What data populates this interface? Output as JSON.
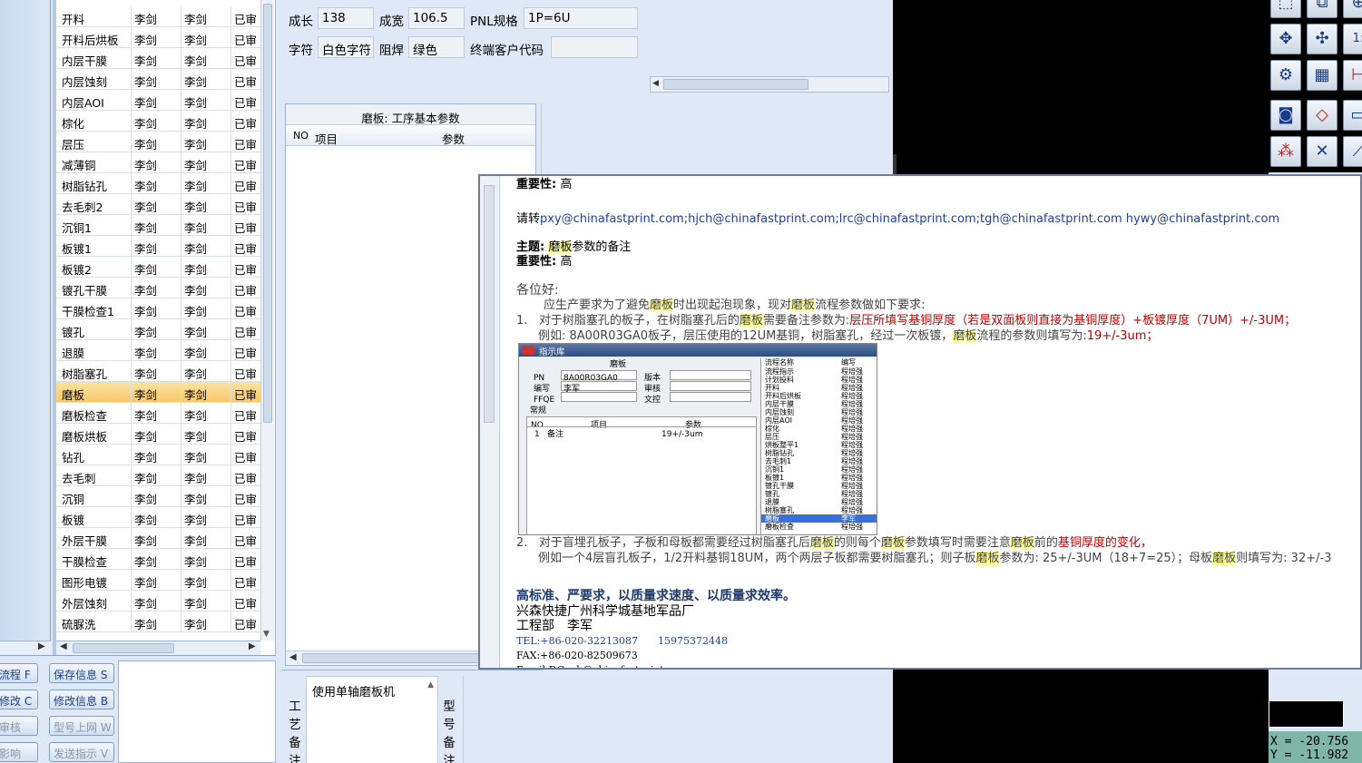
{
  "process_list": {
    "rows": [
      {
        "name": "开料",
        "c1": "李剑",
        "c2": "李剑",
        "c3": "已审"
      },
      {
        "name": "开料后烘板",
        "c1": "李剑",
        "c2": "李剑",
        "c3": "已审"
      },
      {
        "name": "内层干膜",
        "c1": "李剑",
        "c2": "李剑",
        "c3": "已审"
      },
      {
        "name": "内层蚀刻",
        "c1": "李剑",
        "c2": "李剑",
        "c3": "已审"
      },
      {
        "name": "内层AOI",
        "c1": "李剑",
        "c2": "李剑",
        "c3": "已审"
      },
      {
        "name": "棕化",
        "c1": "李剑",
        "c2": "李剑",
        "c3": "已审"
      },
      {
        "name": "层压",
        "c1": "李剑",
        "c2": "李剑",
        "c3": "已审"
      },
      {
        "name": "减薄铜",
        "c1": "李剑",
        "c2": "李剑",
        "c3": "已审"
      },
      {
        "name": "树脂钻孔",
        "c1": "李剑",
        "c2": "李剑",
        "c3": "已审"
      },
      {
        "name": "去毛刺2",
        "c1": "李剑",
        "c2": "李剑",
        "c3": "已审"
      },
      {
        "name": "沉铜1",
        "c1": "李剑",
        "c2": "李剑",
        "c3": "已审"
      },
      {
        "name": "板镀1",
        "c1": "李剑",
        "c2": "李剑",
        "c3": "已审"
      },
      {
        "name": "板镀2",
        "c1": "李剑",
        "c2": "李剑",
        "c3": "已审"
      },
      {
        "name": "镀孔干膜",
        "c1": "李剑",
        "c2": "李剑",
        "c3": "已审"
      },
      {
        "name": "干膜检查1",
        "c1": "李剑",
        "c2": "李剑",
        "c3": "已审"
      },
      {
        "name": "镀孔",
        "c1": "李剑",
        "c2": "李剑",
        "c3": "已审"
      },
      {
        "name": "退膜",
        "c1": "李剑",
        "c2": "李剑",
        "c3": "已审"
      },
      {
        "name": "树脂塞孔",
        "c1": "李剑",
        "c2": "李剑",
        "c3": "已审"
      },
      {
        "name": "磨板",
        "c1": "李剑",
        "c2": "李剑",
        "c3": "已审"
      },
      {
        "name": "磨板检查",
        "c1": "李剑",
        "c2": "李剑",
        "c3": "已审"
      },
      {
        "name": "磨板烘板",
        "c1": "李剑",
        "c2": "李剑",
        "c3": "已审"
      },
      {
        "name": "钻孔",
        "c1": "李剑",
        "c2": "李剑",
        "c3": "已审"
      },
      {
        "name": "去毛刺",
        "c1": "李剑",
        "c2": "李剑",
        "c3": "已审"
      },
      {
        "name": "沉铜",
        "c1": "李剑",
        "c2": "李剑",
        "c3": "已审"
      },
      {
        "name": "板镀",
        "c1": "李剑",
        "c2": "李剑",
        "c3": "已审"
      },
      {
        "name": "外层干膜",
        "c1": "李剑",
        "c2": "李剑",
        "c3": "已审"
      },
      {
        "name": "干膜检查",
        "c1": "李剑",
        "c2": "李剑",
        "c3": "已审"
      },
      {
        "name": "图形电镀",
        "c1": "李剑",
        "c2": "李剑",
        "c3": "已审"
      },
      {
        "name": "外层蚀刻",
        "c1": "李剑",
        "c2": "李剑",
        "c3": "已审"
      },
      {
        "name": "硫脲洗",
        "c1": "李剑",
        "c2": "李剑",
        "c3": "已审"
      }
    ]
  },
  "buttons": {
    "flow": "流程 F",
    "save_info": "保存信息 S",
    "modify_c": "修改 C",
    "modify_info": "修改信息 B",
    "audit": "审核",
    "model_online": "型号上网 W",
    "impact": "影响",
    "send_instruction": "发送指示 V"
  },
  "form": {
    "grow_length_label": "成长",
    "grow_length_value": "138",
    "grow_width_label": "成宽",
    "grow_width_value": "106.5",
    "pnl_label": "PNL规格",
    "pnl_value": "1P=6U",
    "char_label": "字符",
    "char_value": "白色字符",
    "solder_label": "阻焊",
    "solder_value": "绿色",
    "customer_code_label": "终端客户代码",
    "customer_code_value": ""
  },
  "param_panel": {
    "title": "磨板: 工序基本参数",
    "col_no": "NO",
    "col_item": "项目",
    "col_param": "参数"
  },
  "remark": {
    "process_label": "工艺备注",
    "process_text": "使用单轴磨板机",
    "model_label": "型号备注"
  },
  "mail": {
    "importance1_label": "重要性:",
    "importance1_value": "高",
    "please_prefix": "请转",
    "recipients": "pxy@chinafastprint.com;hjch@chinafastprint.com;lrc@chinafastprint.com;tgh@chinafastprint.com hywy@chinafastprint.com",
    "subject_label": "主题:",
    "subject_hl": "磨板",
    "subject_rest": "参数的备注",
    "importance2_label": "重要性:",
    "importance2_value": "高",
    "greeting": "各位好:",
    "intro_a": "应生产要求为了避免",
    "intro_hl1": "磨板",
    "intro_b": "时出现起泡现象，现对",
    "intro_hl2": "磨板",
    "intro_c": "流程参数做如下要求:",
    "item1_num": "1.",
    "item1_a": "对于树脂塞孔的板子，在树脂塞孔后的",
    "item1_hl": "磨板",
    "item1_b": "需要备注参数为:",
    "item1_red": "层压所填写基铜厚度（若是双面板则直接为基铜厚度）+板镀厚度（7UM）+/-3UM；",
    "item1_ex_a": "例如: 8A00R03GA0板子，层压使用的12UM基铜，树脂塞孔，经过一次板镀，",
    "item1_ex_hl": "磨板",
    "item1_ex_b": "流程的参数则填写为:",
    "item1_ex_red": "19+/-3um；",
    "item2_num": "2.",
    "item2_a": "对于盲埋孔板子，子板和母板都需要经过树脂塞孔后",
    "item2_hl1": "磨板",
    "item2_b": "的则每个",
    "item2_hl2": "磨板",
    "item2_c": "参数填写时需要注意",
    "item2_hl3": "磨板",
    "item2_d": "前的",
    "item2_red": "基铜厚度的变化，",
    "item2_ex_a": "例如一个4层盲孔板子，1/2开料基铜18UM，两个两层子板都需要树脂塞孔；则子板",
    "item2_ex_hl1": "磨板",
    "item2_ex_b": "参数为: 25+/-3UM（18+7=25）；母板",
    "item2_ex_hl2": "磨板",
    "item2_ex_c": "则填写为: 32+/-3",
    "slogan": "高标准、严要求，以质量求速度、以质量求效率。",
    "company": "兴森快捷广州科学城基地军品厂",
    "dept": "工程部　李军",
    "tel": "TEL:+86-020-32213087　　15975372448",
    "fax": "FAX:+86-020-82509673",
    "email_partial": "Email:DGzub@chinafastprint.com"
  },
  "embed": {
    "window_title": "指示库",
    "panel_title": "磨板",
    "pn_label": "PN",
    "pn_value": "8A00R03GA0",
    "version_label": "版本",
    "writer_label": "编写",
    "writer_value": "李军",
    "audit_label": "审核",
    "ffqe_label": "FFQE",
    "doc_label": "文控",
    "normal_label": "常规",
    "grid_no": "NO",
    "grid_item": "项目",
    "grid_param": "参数",
    "grid_row_no": "1",
    "grid_row_item": "备注",
    "grid_row_param": "19+/-3um",
    "list_head_name": "流程名称",
    "list_head_writer": "编写",
    "list": [
      {
        "n": "流程指示",
        "v": "程培强"
      },
      {
        "n": "计划投料",
        "v": "程培强"
      },
      {
        "n": "开料",
        "v": "程培强"
      },
      {
        "n": "开料后烘板",
        "v": "程培强"
      },
      {
        "n": "内层干膜",
        "v": "程培强"
      },
      {
        "n": "内层蚀刻",
        "v": "程培强"
      },
      {
        "n": "内层AOI",
        "v": "程培强"
      },
      {
        "n": "棕化",
        "v": "程培强"
      },
      {
        "n": "层压",
        "v": "程培强"
      },
      {
        "n": "烘板整平1",
        "v": "程培强"
      },
      {
        "n": "树脂钻孔",
        "v": "程培强"
      },
      {
        "n": "去毛刺1",
        "v": "程培强"
      },
      {
        "n": "沉铜1",
        "v": "程培强"
      },
      {
        "n": "板镀1",
        "v": "程培强"
      },
      {
        "n": "镀孔干膜",
        "v": "程培强"
      },
      {
        "n": "镀孔",
        "v": "程培强"
      },
      {
        "n": "退膜",
        "v": "程培强"
      },
      {
        "n": "树脂塞孔",
        "v": "程培强"
      },
      {
        "n": "磨板",
        "v": "李军"
      },
      {
        "n": "磨板检查",
        "v": "程培强"
      }
    ]
  },
  "cam": {
    "coord_x": "X = -20.756",
    "coord_y": "Y = -11.982"
  },
  "colors": {
    "selected_row": "#f7c86a",
    "highlight": "#ffff99",
    "red_text": "#c00000",
    "cam_background": "#000000",
    "coord_background": "#7fb6a8"
  }
}
